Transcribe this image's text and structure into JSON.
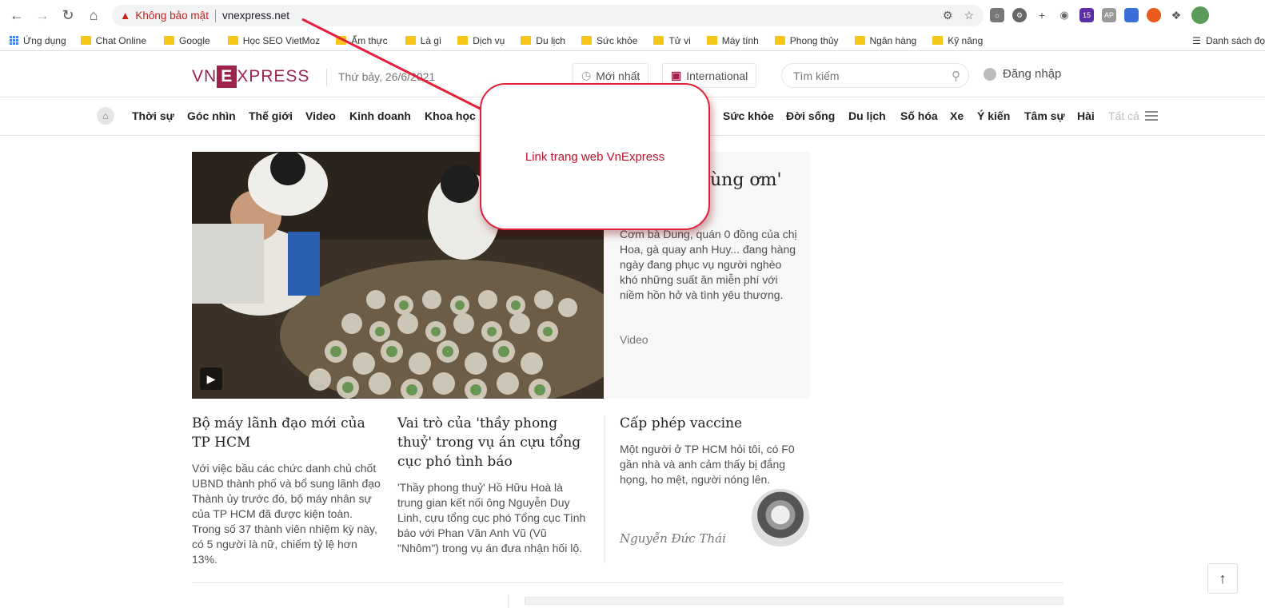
{
  "browser": {
    "security_label": "Không bảo mật",
    "url": "vnexpress.net",
    "extensions": [
      {
        "name": "ext-sun",
        "badge": ""
      },
      {
        "name": "ext-gear",
        "badge": ""
      },
      {
        "name": "ext-plus",
        "badge": ""
      },
      {
        "name": "ext-camera",
        "badge": ""
      },
      {
        "name": "ext-purple",
        "badge": "15"
      },
      {
        "name": "ext-ap",
        "badge": "AP"
      },
      {
        "name": "ext-blue",
        "badge": ""
      },
      {
        "name": "ext-fire",
        "badge": ""
      },
      {
        "name": "ext-puzzle",
        "badge": ""
      },
      {
        "name": "ext-profile",
        "badge": ""
      }
    ]
  },
  "bookmarks": {
    "apps_label": "Ứng dụng",
    "items": [
      "Chat Online",
      "Google",
      "Học SEO VietMoz",
      "Ẩm thực",
      "Là gì",
      "Dịch vụ",
      "Du lịch",
      "Sức khỏe",
      "Tử vi",
      "Máy tính",
      "Phong thủy",
      "Ngân hàng",
      "Kỹ năng"
    ],
    "reading_list": "Danh sách đọ"
  },
  "header": {
    "logo_left": "VN",
    "logo_box": "E",
    "logo_right": "XPRESS",
    "date": "Thứ bảy, 26/6/2021",
    "latest_label": "Mới nhất",
    "international_label": "International",
    "search_placeholder": "Tìm kiếm",
    "login_label": "Đăng nhập"
  },
  "nav": {
    "items": [
      "Thời sự",
      "Góc nhìn",
      "Thế giới",
      "Video",
      "Kinh doanh",
      "Khoa học",
      "Sức khỏe",
      "Đời sống",
      "Du lịch",
      "Số hóa",
      "Xe",
      "Ý kiến",
      "Tâm sự",
      "Hài"
    ],
    "all_label": "Tất cả"
  },
  "hero": {
    "title": "ồn 'cùng ơm'",
    "description": "Cơm bà Dung, quán 0 đồng của chị Hoa, gà quay anh Huy... đang hàng ngày đang phục vụ người nghèo khó những suất ăn miễn phí với niềm hồn hở và tình yêu thương.",
    "tag": "Video"
  },
  "stories": [
    {
      "title": "Bộ máy lãnh đạo mới của TP HCM",
      "description": "Với việc bầu các chức danh chủ chốt UBND thành phố và bổ sung lãnh đạo Thành ủy trước đó, bộ máy nhân sự của TP HCM đã được kiện toàn. Trong số 37 thành viên nhiệm kỳ này, có 5 người là nữ, chiếm tỷ lệ hơn 13%."
    },
    {
      "title": "Vai trò của 'thầy phong thuỷ' trong vụ án cựu tổng cục phó tình báo",
      "description": "'Thầy phong thuỷ' Hồ Hữu Hoà là trung gian kết nối ông Nguyễn Duy Linh, cựu tổng cục phó Tổng cục Tình báo với Phan Văn Anh Vũ (Vũ \"Nhôm\") trong vụ án đưa nhận hối lộ."
    },
    {
      "title": "Cấp phép vaccine",
      "description": "Một người ở TP HCM hỏi tôi, có F0 gần nhà và anh cảm thấy bị đắng họng, ho mệt, người nóng lên.",
      "author": "Nguyễn Đức Thái"
    }
  ],
  "annotation": {
    "text": "Link trang web VnExpress",
    "color": "#e3203a"
  }
}
